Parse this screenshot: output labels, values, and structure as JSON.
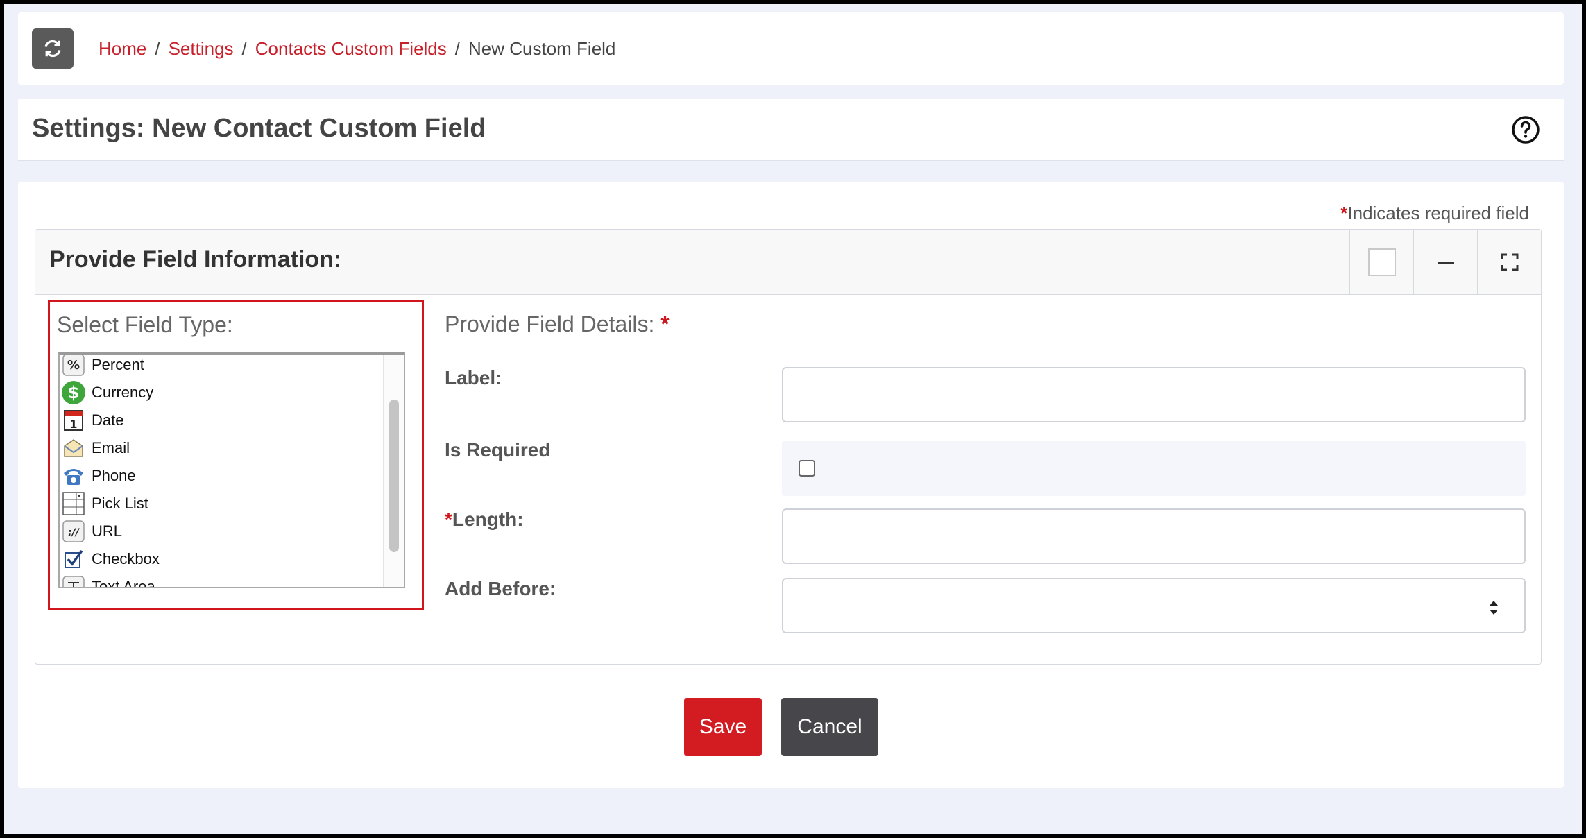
{
  "breadcrumb": {
    "items": [
      {
        "label": "Home"
      },
      {
        "label": "Settings"
      },
      {
        "label": "Contacts Custom Fields"
      }
    ],
    "current": "New Custom Field",
    "separator": "/"
  },
  "page": {
    "title": "Settings: New Contact Custom Field",
    "required_note": "Indicates required field",
    "required_star": "*"
  },
  "panel": {
    "title": "Provide Field Information:"
  },
  "field_type": {
    "heading": "Select Field Type:",
    "options": [
      {
        "label": "Percent",
        "icon": "percent-icon"
      },
      {
        "label": "Currency",
        "icon": "currency-icon"
      },
      {
        "label": "Date",
        "icon": "calendar-icon"
      },
      {
        "label": "Email",
        "icon": "email-icon"
      },
      {
        "label": "Phone",
        "icon": "phone-icon"
      },
      {
        "label": "Pick List",
        "icon": "picklist-icon"
      },
      {
        "label": "URL",
        "icon": "url-icon"
      },
      {
        "label": "Checkbox",
        "icon": "checkbox-icon"
      },
      {
        "label": "Text Area",
        "icon": "textarea-icon"
      }
    ]
  },
  "details": {
    "heading": "Provide Field Details:",
    "label_field": {
      "label": "Label:",
      "value": ""
    },
    "is_required": {
      "label": "Is Required",
      "checked": false
    },
    "length_field": {
      "label": "Length:",
      "value": ""
    },
    "add_before": {
      "label": "Add Before:",
      "value": ""
    }
  },
  "buttons": {
    "save": "Save",
    "cancel": "Cancel"
  },
  "colors": {
    "accent": "#d31c22",
    "link": "#c8202a",
    "cancel": "#47474b"
  }
}
